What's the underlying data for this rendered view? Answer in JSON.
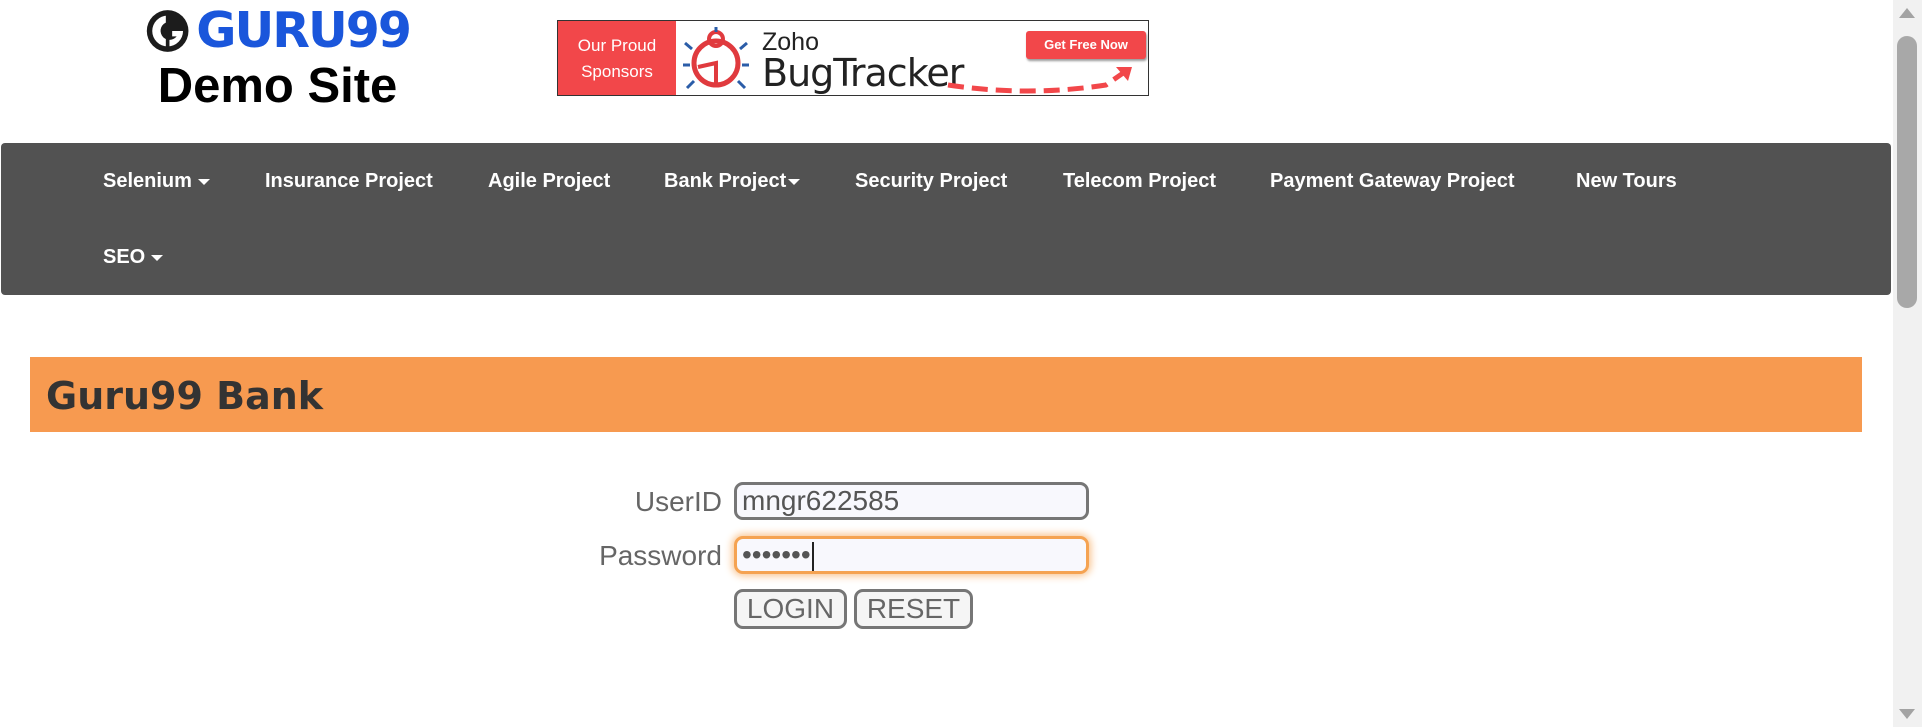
{
  "header": {
    "brand_name": "GURU99",
    "brand_subtitle": "Demo Site",
    "sponsor": {
      "tag_line1": "Our Proud",
      "tag_line2": "Sponsors",
      "brand": "Zoho",
      "product": "BugTracker",
      "cta": "Get Free Now"
    }
  },
  "nav": {
    "items": [
      {
        "label": "Selenium",
        "dropdown": true
      },
      {
        "label": "Insurance Project",
        "dropdown": false
      },
      {
        "label": "Agile Project",
        "dropdown": false
      },
      {
        "label": "Bank Project",
        "dropdown": true
      },
      {
        "label": "Security Project",
        "dropdown": false
      },
      {
        "label": "Telecom Project",
        "dropdown": false
      },
      {
        "label": "Payment Gateway Project",
        "dropdown": false
      },
      {
        "label": "New Tours",
        "dropdown": false
      },
      {
        "label": "SEO",
        "dropdown": true
      }
    ]
  },
  "bank": {
    "title": "Guru99 Bank"
  },
  "login_form": {
    "userid_label": "UserID",
    "userid_value": "mngr622585",
    "password_label": "Password",
    "password_value": "•••••••",
    "login_button": "LOGIN",
    "reset_button": "RESET"
  },
  "colors": {
    "nav_bg": "#525252",
    "banner_bg": "#f79a50",
    "brand_blue": "#1a56db",
    "sponsor_red": "#f2474a",
    "focus_orange": "#f5a352"
  },
  "icons": {
    "brand_logo": "guru99-logo-icon",
    "sponsor_bug": "bug-icon",
    "sponsor_arrow": "dashed-arrow-icon"
  }
}
